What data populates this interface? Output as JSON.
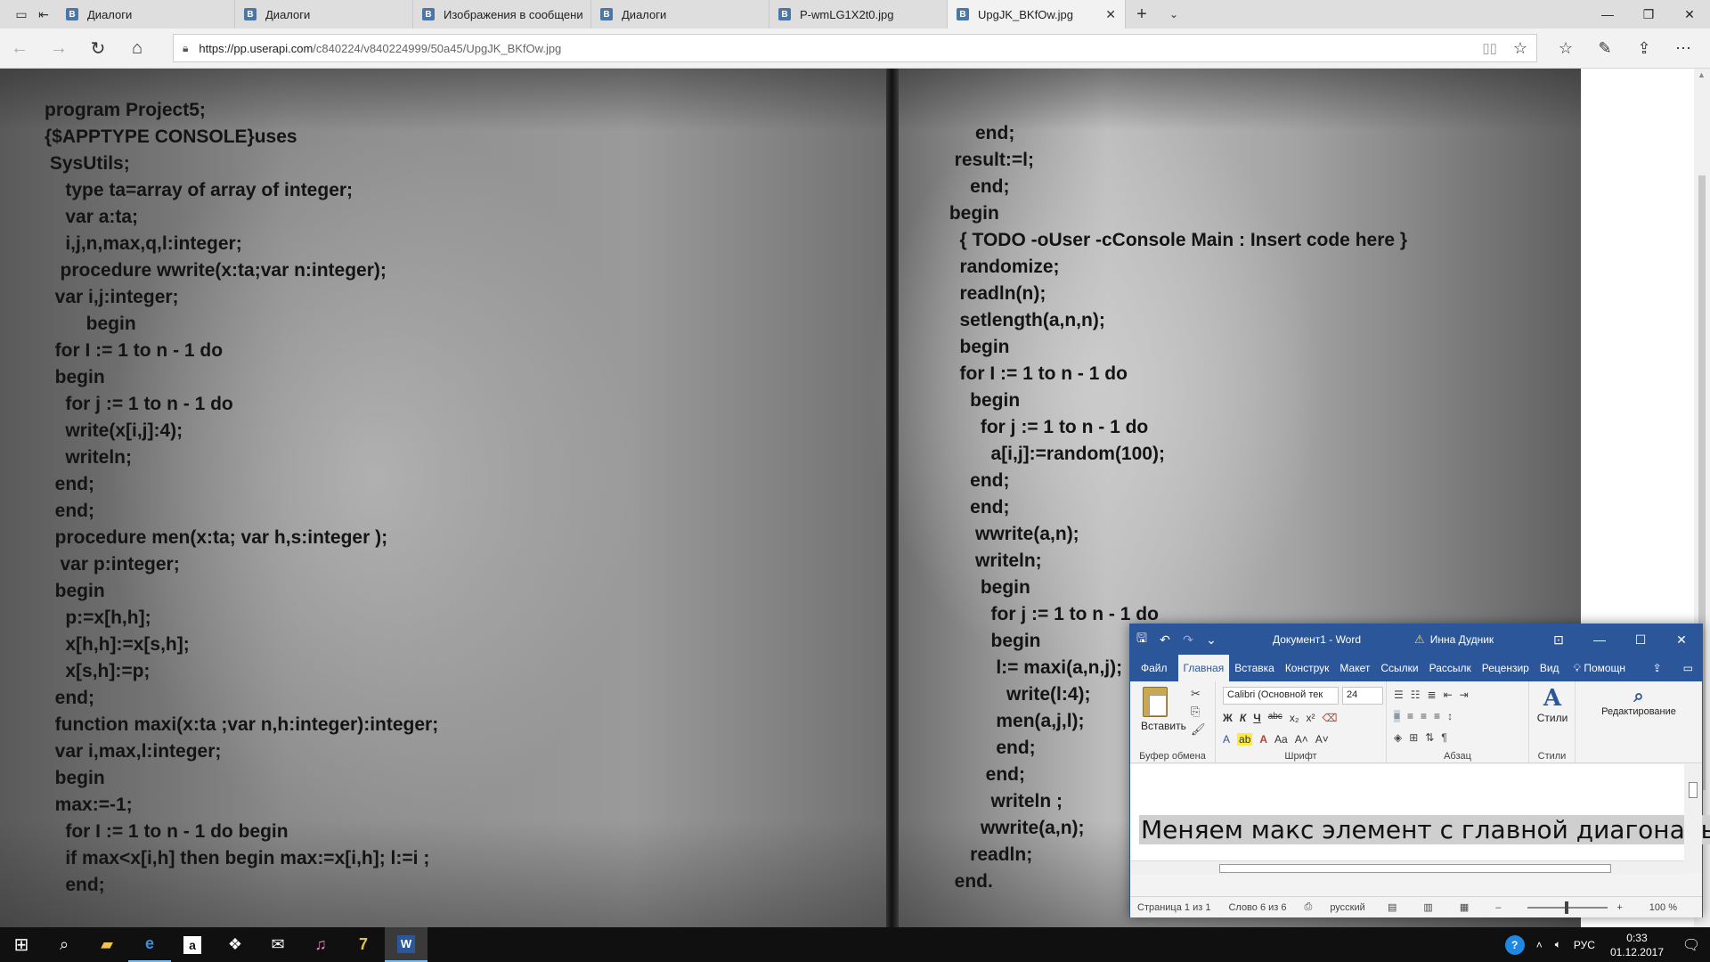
{
  "browser": {
    "tabs": [
      {
        "label": "Диалоги",
        "favicon": "В"
      },
      {
        "label": "Диалоги",
        "favicon": "В"
      },
      {
        "label": "Изображения в сообщени",
        "favicon": "В"
      },
      {
        "label": "Диалоги",
        "favicon": "В"
      },
      {
        "label": "P-wmLG1X2t0.jpg",
        "favicon": "В"
      },
      {
        "label": "UpgJK_BKfOw.jpg",
        "favicon": "В"
      }
    ],
    "url": {
      "host": "https://pp.userapi.com",
      "path": "/c840224/v840224999/50a45/UpgJK_BKfOw.jpg"
    },
    "icons": [
      "tabs-icon",
      "back-icon",
      "forward-icon",
      "refresh-icon",
      "home-icon",
      "lock-icon",
      "reading-view-icon",
      "favorite-star-icon",
      "hub-icon",
      "notes-icon",
      "share-icon",
      "more-icon"
    ]
  },
  "photo": {
    "left_code": [
      "program Project5;",
      "{$APPTYPE CONSOLE}uses",
      " SysUtils;",
      "    type ta=array of array of integer;",
      "    var a:ta;",
      "    i,j,n,max,q,l:integer;",
      "   procedure wwrite(x:ta;var n:integer);",
      "  var i,j:integer;",
      "        begin",
      "  for I := 1 to n - 1 do",
      "  begin",
      "    for j := 1 to n - 1 do",
      "    write(x[i,j]:4);",
      "    writeln;",
      "  end;",
      "  end;",
      "  procedure men(x:ta; var h,s:integer );",
      "   var p:integer;",
      "  begin",
      "    p:=x[h,h];",
      "    x[h,h]:=x[s,h];",
      "    x[s,h]:=p;",
      "  end;",
      "  function maxi(x:ta ;var n,h:integer):integer;",
      "  var i,max,l:integer;",
      "  begin",
      "  max:=-1;",
      "    for I := 1 to n - 1 do begin",
      "    if max<x[i,h] then begin max:=x[i,h]; l:=i ;",
      "    end;"
    ],
    "right_code": [
      "      end;",
      "  result:=l;",
      "     end;",
      " begin",
      "   { TODO -oUser -cConsole Main : Insert code here }",
      "   randomize;",
      "   readln(n);",
      "   setlength(a,n,n);",
      "   begin",
      "   for I := 1 to n - 1 do",
      "     begin",
      "       for j := 1 to n - 1 do",
      "         a[i,j]:=random(100);",
      "     end;",
      "     end;",
      "      wwrite(a,n);",
      "      writeln;",
      "       begin",
      "         for j := 1 to n - 1 do",
      "         begin",
      "          l:= maxi(a,n,j);",
      "            write(l:4);",
      "          men(a,j,l);",
      "          end;",
      "        end;",
      "         writeln ;",
      "       wwrite(a,n);",
      "     readln;",
      "  end."
    ]
  },
  "word": {
    "title": "Документ1  -  Word",
    "user": "Инна Дудник",
    "tabs": [
      "Файл",
      "Главная",
      "Вставка",
      "Конструк",
      "Макет",
      "Ссылки",
      "Рассылк",
      "Рецензир",
      "Вид"
    ],
    "tell_me": "Помощн",
    "clipboard": {
      "paste_label": "Вставить",
      "group_label": "Буфер обмена"
    },
    "font": {
      "name": "Calibri (Основной тек",
      "size": "24",
      "group_label": "Шрифт",
      "bold": "Ж",
      "italic": "К",
      "underline": "Ч",
      "strike": "abc",
      "sub": "x₂",
      "sup": "x²",
      "aa": "Aa",
      "grow": "A˄",
      "shrink": "A˅"
    },
    "paragraph": {
      "group_label": "Абзац"
    },
    "styles": {
      "label": "Стили",
      "group_label": "Стили"
    },
    "editing": {
      "label": "Редактирование"
    },
    "document_text": "Меняем макс элемент с главной диагональю",
    "status": {
      "page": "Страница 1 из 1",
      "words": "Слово 6 из 6",
      "language": "русский",
      "zoom": "100 %"
    }
  },
  "taskbar": {
    "lang": "РУС",
    "time": "0:33",
    "date": "01.12.2017"
  }
}
